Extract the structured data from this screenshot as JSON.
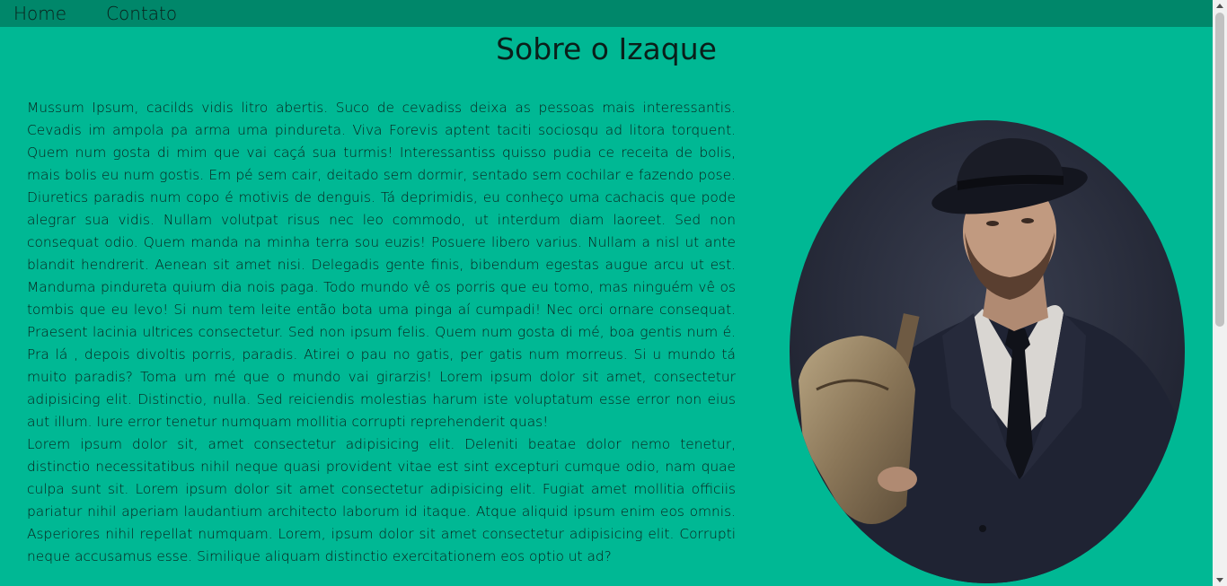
{
  "nav": {
    "home_label": "Home",
    "contact_label": "Contato"
  },
  "header": {
    "title": "Sobre o Izaque"
  },
  "article": {
    "paragraph_1": "Mussum Ipsum, cacilds vidis litro abertis. Suco de cevadiss deixa as pessoas mais interessantis. Cevadis im ampola pa arma uma pindureta. Viva Forevis aptent taciti sociosqu ad litora torquent. Quem num gosta di mim que vai caçá sua turmis! Interessantiss quisso pudia ce receita de bolis, mais bolis eu num gostis. Em pé sem cair, deitado sem dormir, sentado sem cochilar e fazendo pose. Diuretics paradis num copo é motivis de denguis. Tá deprimidis, eu conheço uma cachacis que pode alegrar sua vidis. Nullam volutpat risus nec leo commodo, ut interdum diam laoreet. Sed non consequat odio. Quem manda na minha terra sou euzis! Posuere libero varius. Nullam a nisl ut ante blandit hendrerit. Aenean sit amet nisi. Delegadis gente finis, bibendum egestas augue arcu ut est. Manduma pindureta quium dia nois paga. Todo mundo vê os porris que eu tomo, mas ninguém vê os tombis que eu levo! Si num tem leite então bota uma pinga aí cumpadi! Nec orci ornare consequat. Praesent lacinia ultrices consectetur. Sed non ipsum felis. Quem num gosta di mé, boa gentis num é. Pra lá , depois divoltis porris, paradis. Atirei o pau no gatis, per gatis num morreus. Si u mundo tá muito paradis? Toma um mé que o mundo vai girarzis! Lorem ipsum dolor sit amet, consectetur adipisicing elit. Distinctio, nulla. Sed reiciendis molestias harum iste voluptatum esse error non eius aut illum. Iure error tenetur numquam mollitia corrupti reprehenderit quas!",
    "paragraph_2": "Lorem ipsum dolor sit, amet consectetur adipisicing elit. Deleniti beatae dolor nemo tenetur, distinctio necessitatibus nihil neque quasi provident vitae est sint excepturi cumque odio, nam quae culpa sunt sit. Lorem ipsum dolor sit amet consectetur adipisicing elit. Fugiat amet mollitia officiis pariatur nihil aperiam laudantium architecto laborum id itaque. Atque aliquid ipsum enim eos omnis. Asperiores nihil repellat numquam. Lorem, ipsum dolor sit amet consectetur adipisicing elit. Corrupti neque accusamus esse. Similique aliquam distinctio exercitationem eos optio ut ad?"
  },
  "colors": {
    "background": "#00b894",
    "nav_background": "#00876a",
    "text": "#0a1f1a"
  },
  "portrait": {
    "shape": "oval"
  }
}
